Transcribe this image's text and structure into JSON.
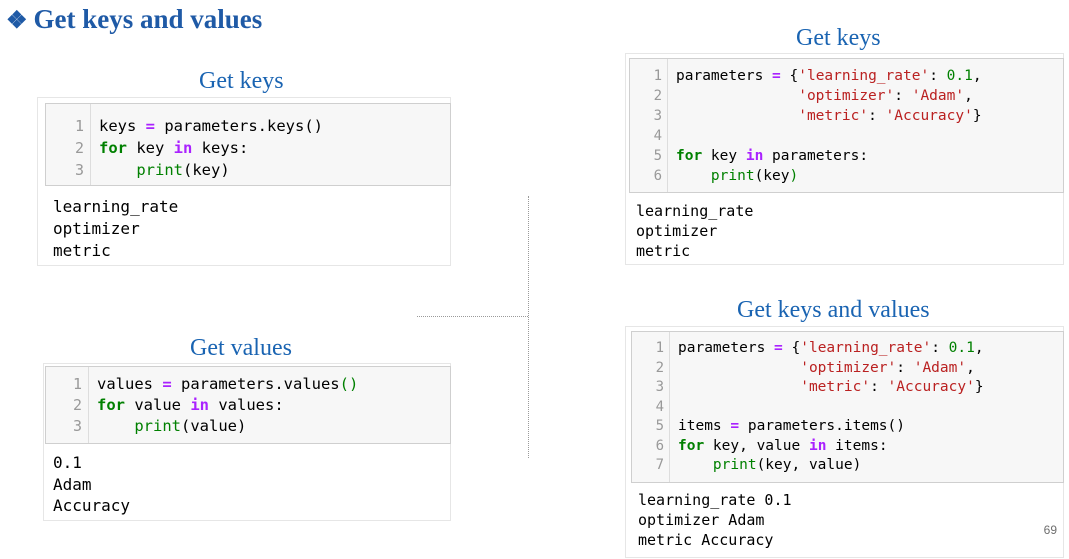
{
  "title": {
    "bullet": "❖",
    "text": "Get keys and values"
  },
  "page_number": "69",
  "panel_keys_left": {
    "title": "Get keys",
    "line_numbers": [
      "1",
      "2",
      "3"
    ],
    "code": [
      [
        {
          "t": "keys "
        },
        {
          "t": "=",
          "c": "op"
        },
        {
          "t": " parameters.keys()"
        }
      ],
      [
        {
          "t": "for",
          "c": "kw"
        },
        {
          "t": " key "
        },
        {
          "t": "in",
          "c": "op"
        },
        {
          "t": " keys:"
        }
      ],
      [
        {
          "t": "    "
        },
        {
          "t": "print",
          "c": "bi"
        },
        {
          "t": "(key)"
        }
      ]
    ],
    "output": [
      "learning_rate",
      "optimizer",
      "metric"
    ]
  },
  "panel_values": {
    "title": "Get values",
    "line_numbers": [
      "1",
      "2",
      "3"
    ],
    "code": [
      [
        {
          "t": "values "
        },
        {
          "t": "=",
          "c": "op"
        },
        {
          "t": " parameters.values"
        },
        {
          "t": "()",
          "c": "bi"
        }
      ],
      [
        {
          "t": "for",
          "c": "kw"
        },
        {
          "t": " value "
        },
        {
          "t": "in",
          "c": "op"
        },
        {
          "t": " values:"
        }
      ],
      [
        {
          "t": "    "
        },
        {
          "t": "print",
          "c": "bi"
        },
        {
          "t": "(value)"
        }
      ]
    ],
    "output": [
      "0.1",
      "Adam",
      "Accuracy"
    ]
  },
  "panel_keys_right": {
    "title": "Get keys",
    "line_numbers": [
      "1",
      "2",
      "3",
      "4",
      "5",
      "6"
    ],
    "code": [
      [
        {
          "t": "parameters "
        },
        {
          "t": "=",
          "c": "op"
        },
        {
          "t": " {"
        },
        {
          "t": "'learning_rate'",
          "c": "str"
        },
        {
          "t": ": "
        },
        {
          "t": "0.1",
          "c": "num"
        },
        {
          "t": ","
        }
      ],
      [
        {
          "t": "              "
        },
        {
          "t": "'optimizer'",
          "c": "str"
        },
        {
          "t": ": "
        },
        {
          "t": "'Adam'",
          "c": "str"
        },
        {
          "t": ","
        }
      ],
      [
        {
          "t": "              "
        },
        {
          "t": "'metric'",
          "c": "str"
        },
        {
          "t": ": "
        },
        {
          "t": "'Accuracy'",
          "c": "str"
        },
        {
          "t": "}"
        }
      ],
      [
        {
          "t": ""
        }
      ],
      [
        {
          "t": "for",
          "c": "kw"
        },
        {
          "t": " key "
        },
        {
          "t": "in",
          "c": "op"
        },
        {
          "t": " parameters:"
        }
      ],
      [
        {
          "t": "    "
        },
        {
          "t": "print",
          "c": "bi"
        },
        {
          "t": "(key"
        },
        {
          "t": ")",
          "c": "bi"
        }
      ]
    ],
    "output": [
      "learning_rate",
      "optimizer",
      "metric"
    ]
  },
  "panel_items": {
    "title": "Get keys and values",
    "line_numbers": [
      "1",
      "2",
      "3",
      "4",
      "5",
      "6",
      "7"
    ],
    "code": [
      [
        {
          "t": "parameters "
        },
        {
          "t": "=",
          "c": "op"
        },
        {
          "t": " {"
        },
        {
          "t": "'learning_rate'",
          "c": "str"
        },
        {
          "t": ": "
        },
        {
          "t": "0.1",
          "c": "num"
        },
        {
          "t": ","
        }
      ],
      [
        {
          "t": "              "
        },
        {
          "t": "'optimizer'",
          "c": "str"
        },
        {
          "t": ": "
        },
        {
          "t": "'Adam'",
          "c": "str"
        },
        {
          "t": ","
        }
      ],
      [
        {
          "t": "              "
        },
        {
          "t": "'metric'",
          "c": "str"
        },
        {
          "t": ": "
        },
        {
          "t": "'Accuracy'",
          "c": "str"
        },
        {
          "t": "}"
        }
      ],
      [
        {
          "t": ""
        }
      ],
      [
        {
          "t": "items "
        },
        {
          "t": "=",
          "c": "op"
        },
        {
          "t": " parameters.items()"
        }
      ],
      [
        {
          "t": "for",
          "c": "kw"
        },
        {
          "t": " key, value "
        },
        {
          "t": "in",
          "c": "op"
        },
        {
          "t": " items:"
        }
      ],
      [
        {
          "t": "    "
        },
        {
          "t": "print",
          "c": "bi"
        },
        {
          "t": "(key, value)"
        }
      ]
    ],
    "output": [
      "learning_rate 0.1",
      "optimizer Adam",
      "metric Accuracy"
    ]
  }
}
